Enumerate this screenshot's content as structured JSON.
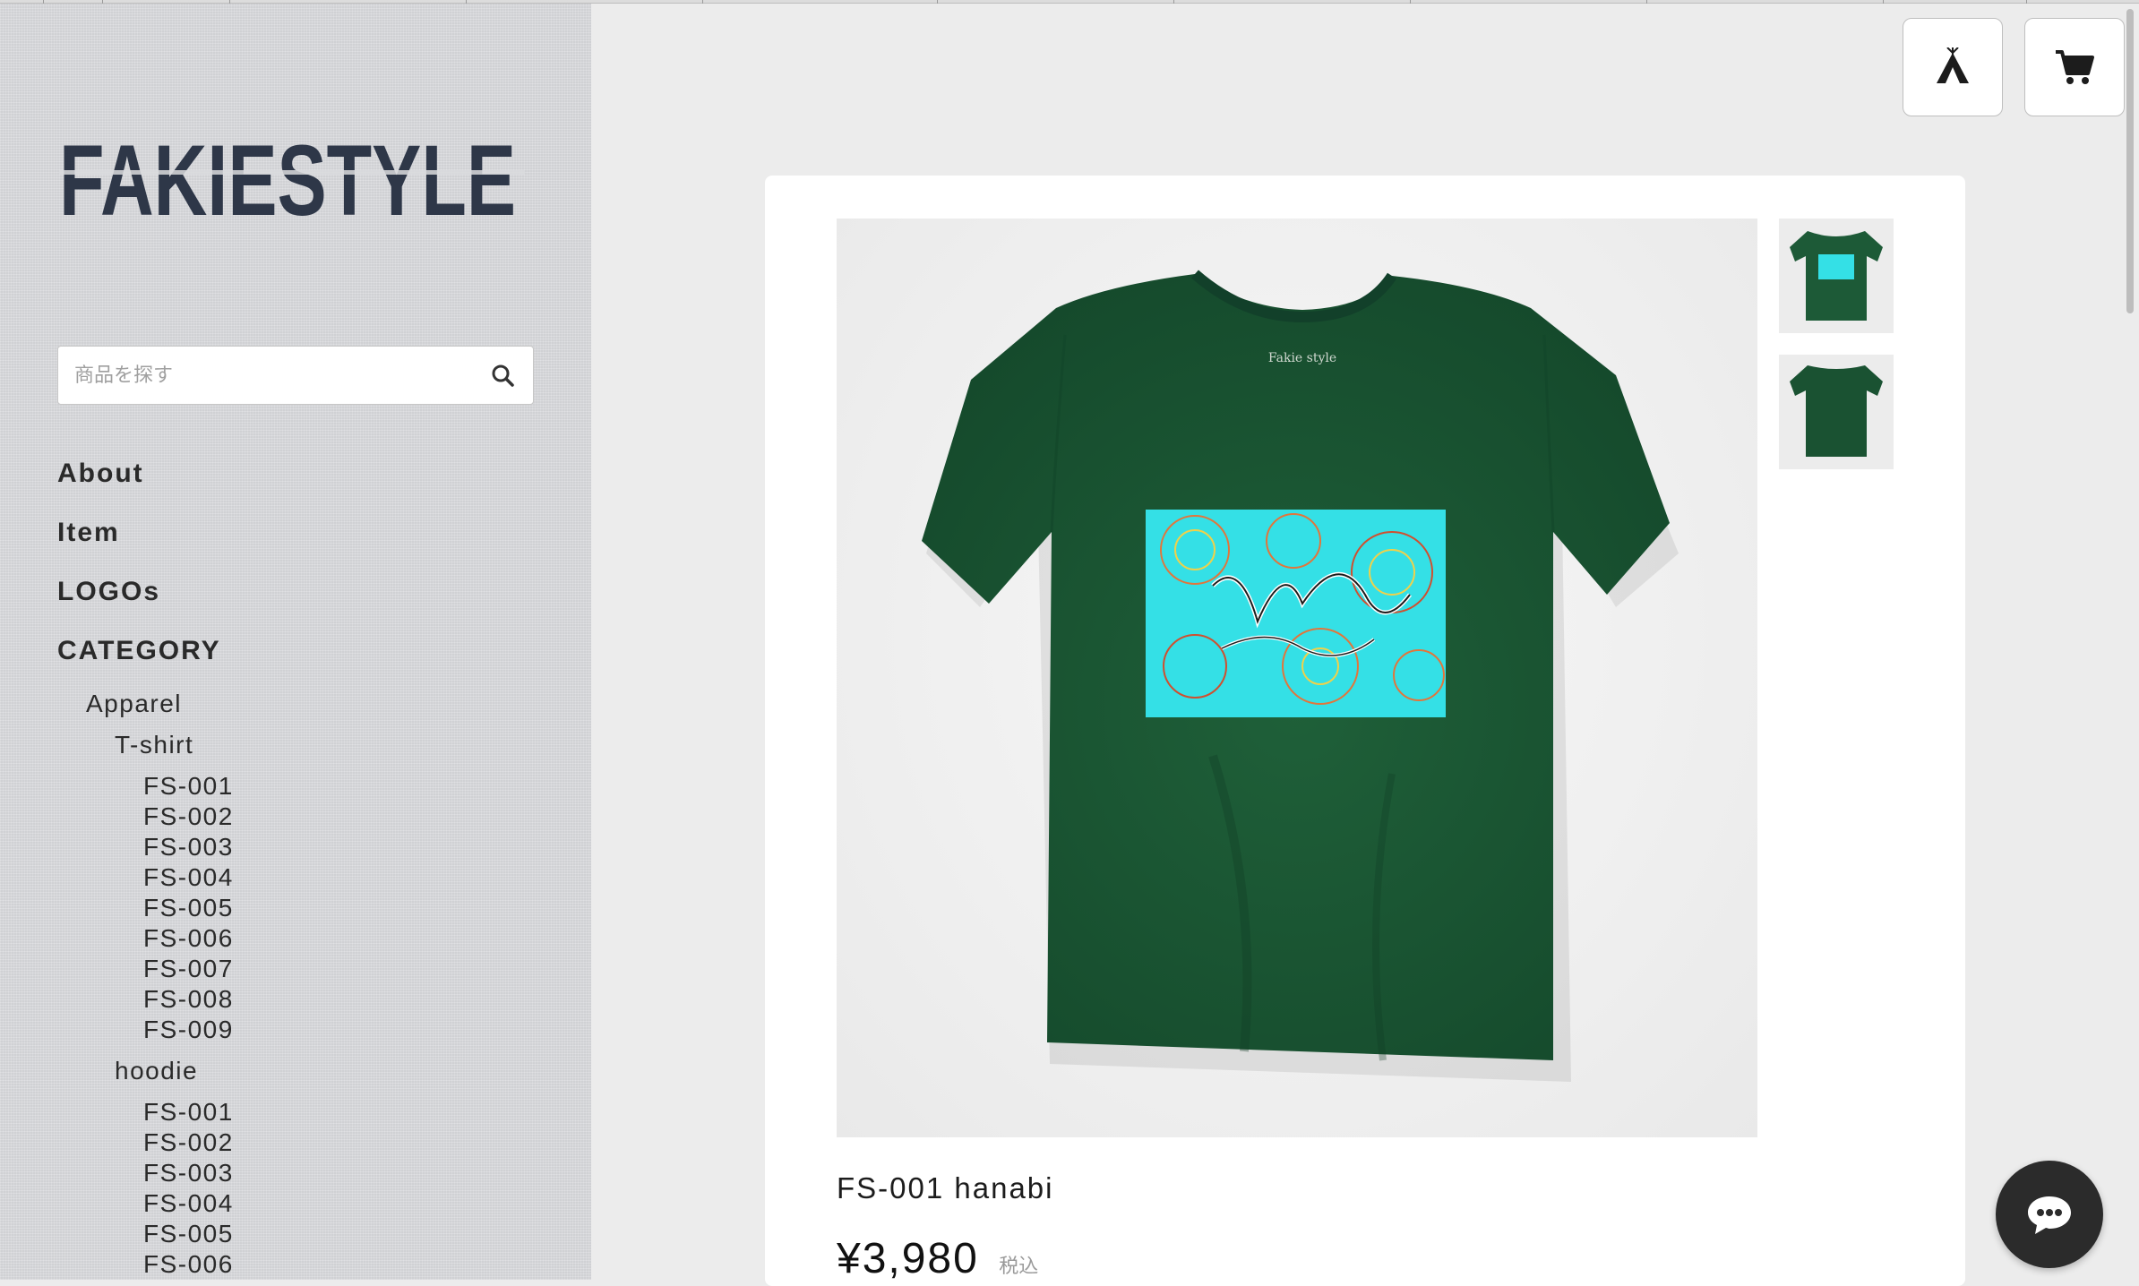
{
  "brand": {
    "logo_text": "FAKIESTYLE",
    "logo_color": "#2e3748"
  },
  "search": {
    "placeholder": "商品を探す",
    "icon": "search-icon"
  },
  "nav": {
    "about": "About",
    "item": "Item",
    "logos": "LOGOs",
    "category": "CATEGORY",
    "apparel": "Apparel",
    "tshirt": "T-shirt",
    "tshirt_items": [
      "FS-001",
      "FS-002",
      "FS-003",
      "FS-004",
      "FS-005",
      "FS-006",
      "FS-007",
      "FS-008",
      "FS-009"
    ],
    "hoodie": "hoodie",
    "hoodie_items": [
      "FS-001",
      "FS-002",
      "FS-003",
      "FS-004",
      "FS-005",
      "FS-006"
    ]
  },
  "header_icons": {
    "home": "tent-icon",
    "cart": "cart-icon"
  },
  "product": {
    "title": "FS-001 hanabi",
    "price": "¥3,980",
    "tax_label": "税込",
    "shirt_color": "#1d5a37",
    "print_color": "#34e0e6",
    "collar_label": "Fakie style"
  },
  "chat": {
    "icon": "chat-bubble-icon"
  }
}
